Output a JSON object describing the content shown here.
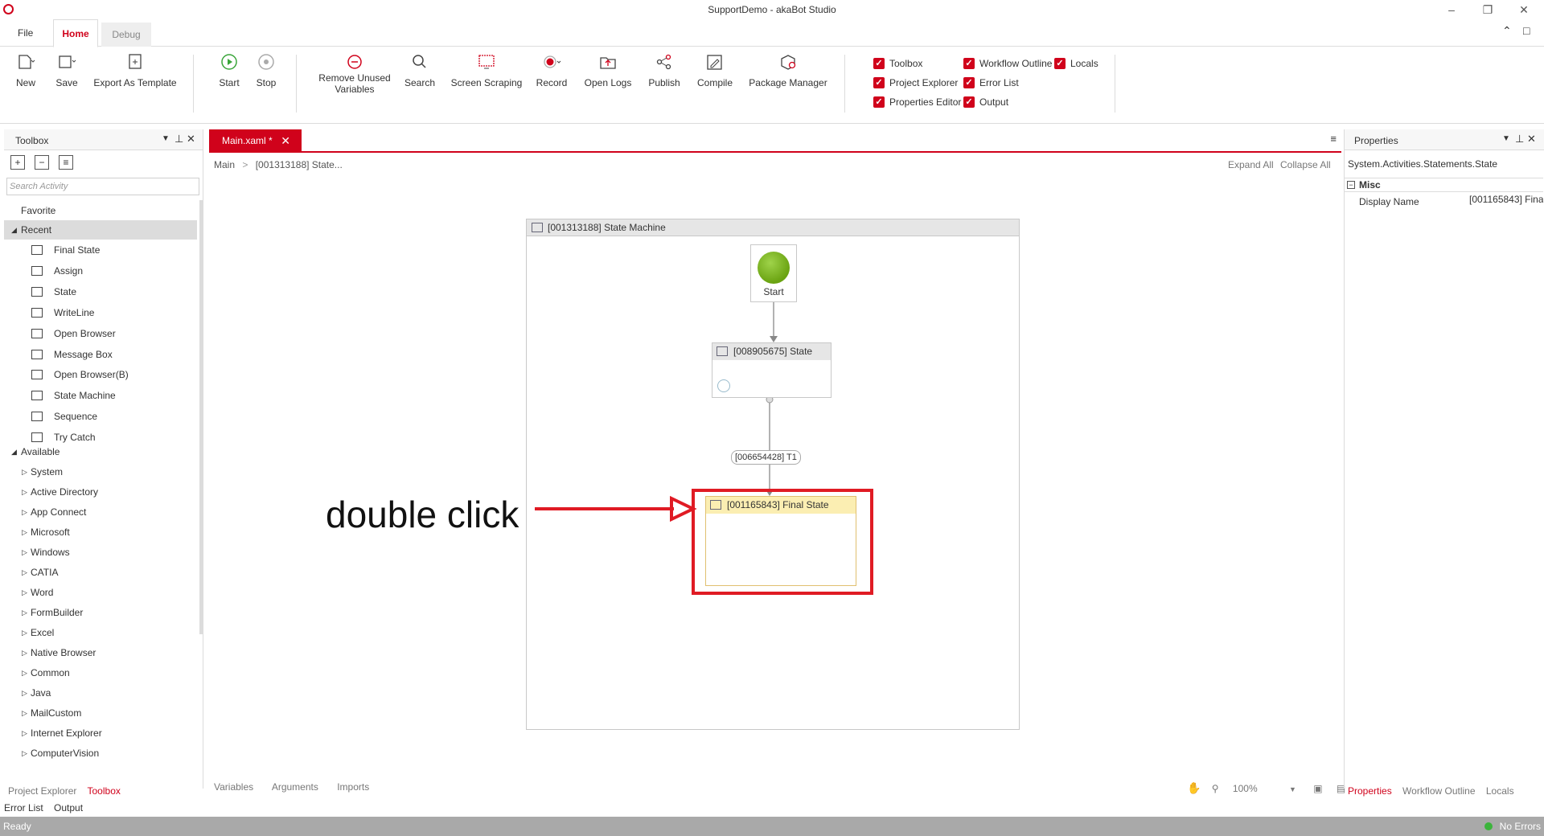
{
  "window": {
    "title": "SupportDemo - akaBot Studio"
  },
  "tabs": {
    "file": "File",
    "home": "Home",
    "debug": "Debug"
  },
  "ribbon": {
    "new": "New",
    "save": "Save",
    "export": "Export As Template",
    "start": "Start",
    "stop": "Stop",
    "remove_unused_1": "Remove Unused",
    "remove_unused_2": "Variables",
    "search": "Search",
    "screen_scraping": "Screen Scraping",
    "record": "Record",
    "open_logs": "Open Logs",
    "publish": "Publish",
    "compile": "Compile",
    "package_manager": "Package Manager",
    "toggles": {
      "toolbox": "Toolbox",
      "project_explorer": "Project Explorer",
      "properties_editor": "Properties Editor",
      "workflow_outline": "Workflow Outline",
      "error_list": "Error List",
      "output": "Output",
      "locals": "Locals"
    }
  },
  "toolbox": {
    "title": "Toolbox",
    "search_placeholder": "Search Activity",
    "favorite": "Favorite",
    "recent": "Recent",
    "recent_items": [
      "Final State",
      "Assign",
      "State",
      "WriteLine",
      "Open Browser",
      "Message Box",
      "Open Browser(B)",
      "State Machine",
      "Sequence",
      "Try Catch"
    ],
    "available": "Available",
    "available_items": [
      "System",
      "Active Directory",
      "App Connect",
      "Microsoft",
      "Windows",
      "CATIA",
      "Word",
      "FormBuilder",
      "Excel",
      "Native Browser",
      "Common",
      "Java",
      "MailCustom",
      "Internet Explorer",
      "ComputerVision"
    ],
    "bottom_tabs": [
      "Project Explorer",
      "Toolbox"
    ],
    "bottom_tabs2": [
      "Error List",
      "Output"
    ]
  },
  "document": {
    "tab": "Main.xaml *",
    "breadcrumb_root": "Main",
    "breadcrumb_sep": ">",
    "breadcrumb_current": "[001313188] State...",
    "expand_all": "Expand All",
    "collapse_all": "Collapse All"
  },
  "designer": {
    "state_machine": "[001313188] State Machine",
    "start": "Start",
    "state": "[008905675] State",
    "transition": "[006654428] T1",
    "final_state": "[001165843] Final State",
    "annotation": "double click",
    "bottom_tabs": [
      "Variables",
      "Arguments",
      "Imports"
    ],
    "zoom": "100%"
  },
  "properties": {
    "title": "Properties",
    "type": "System.Activities.Statements.State",
    "category": "Misc",
    "display_name_label": "Display Name",
    "display_name_value": "[001165843] Fina",
    "bottom_tabs": [
      "Properties",
      "Workflow Outline",
      "Locals"
    ]
  },
  "status": {
    "left": "Ready",
    "right": "No Errors"
  },
  "colors": {
    "accent": "#d0021b",
    "status_bar": "#a9a9a9",
    "final_state_header": "#fbeeb2"
  }
}
